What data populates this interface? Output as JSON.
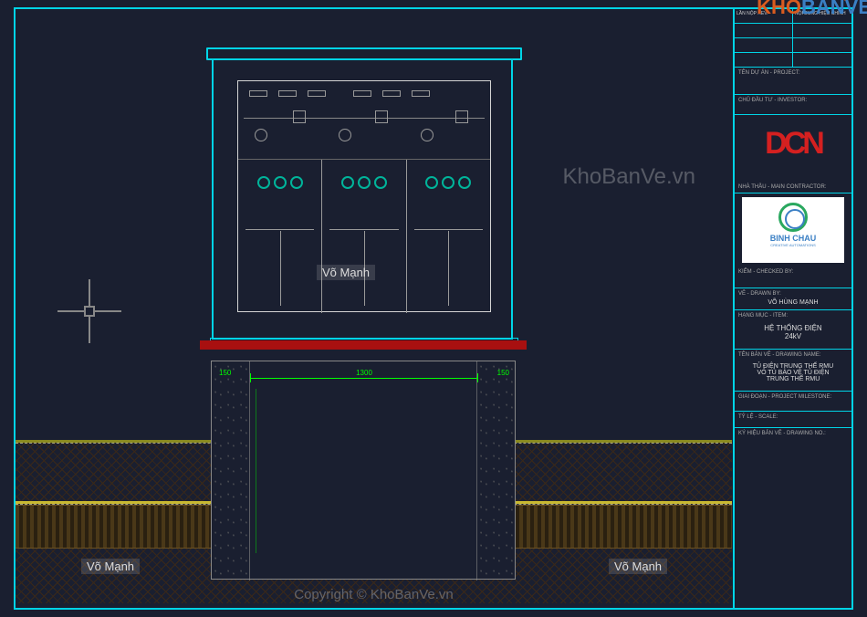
{
  "watermarks": {
    "logo_text_1": "KHO",
    "logo_text_2": "BANVE",
    "url": "KhoBanVe.vn",
    "copyright": "Copyright © KhoBanVe.vn"
  },
  "author_tags": {
    "tag": "Võ Mạnh"
  },
  "title_block": {
    "top_labels": {
      "r1c1": "LẦN NỘP REV.",
      "r1c2": "NỘI DUNG HIỆU CHỈNH"
    },
    "project_label": "TÊN DỰ ÁN - PROJECT:",
    "owner_label": "CHỦ ĐẦU TƯ - INVESTOR:",
    "consultant_label": "NHÀ THẦU - MAIN CONTRACTOR:",
    "dcn_logo": "DCN",
    "bc_name": "BINH CHAU",
    "bc_sub": "CREATIVE AUTOMATIONS",
    "check_label": "KIỂM - CHECKED BY:",
    "draw_label": "VẼ - DRAWN BY:",
    "draw_value": "VÕ HÙNG MẠNH",
    "item_label": "HẠNG MỤC - ITEM:",
    "item_value_1": "HỆ THỐNG ĐIỆN",
    "item_value_2": "24kV",
    "dwg_label": "TÊN BẢN VẼ - DRAWING NAME:",
    "dwg_value_1": "TỦ ĐIỆN TRUNG THẾ RMU",
    "dwg_value_2": "VỎ TỦ BẢO VỆ TỦ ĐIỆN",
    "dwg_value_3": "TRUNG THẾ RMU",
    "milestone_label": "GIAI ĐOẠN - PROJECT MILESTONE:",
    "scale_label": "TỶ LỆ - SCALE:",
    "dwgno_label": "KÝ HIỆU BẢN VẼ - DRAWING NO.:"
  },
  "dimensions": {
    "pit_width": "1300",
    "wall_l": "150",
    "wall_r": "150"
  }
}
